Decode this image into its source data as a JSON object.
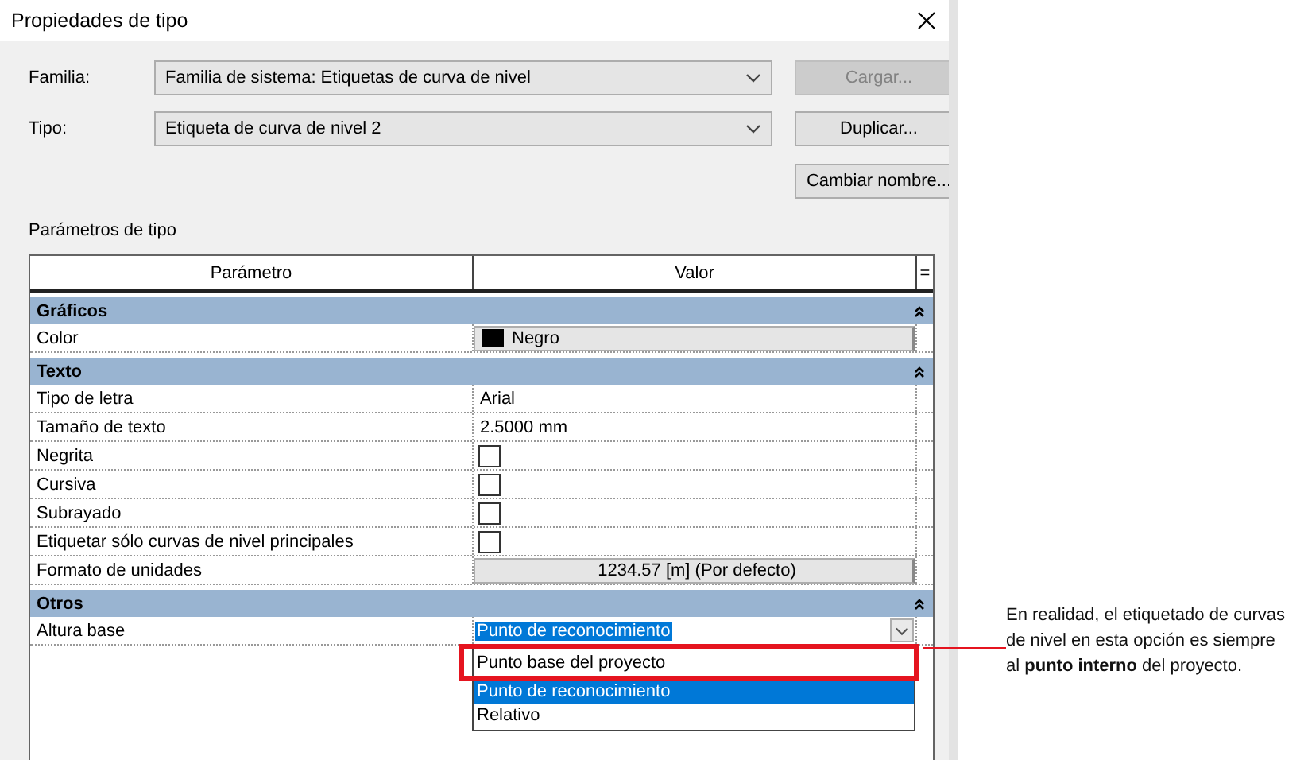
{
  "window": {
    "title": "Propiedades de tipo"
  },
  "selectors": [
    {
      "label": "Familia:",
      "value": "Familia de sistema: Etiquetas de curva de nivel"
    },
    {
      "label": "Tipo:",
      "value": "Etiqueta de curva de nivel 2"
    }
  ],
  "buttons": [
    {
      "label": "Cargar...",
      "disabled": true
    },
    {
      "label": "Duplicar...",
      "disabled": false
    },
    {
      "label": "Cambiar nombre...",
      "disabled": false
    }
  ],
  "parameters_label": "Parámetros de tipo",
  "table": {
    "columns": [
      "Parámetro",
      "Valor",
      "="
    ],
    "groups": [
      {
        "name": "Gráficos",
        "expanded": true,
        "rows": [
          {
            "name": "Color",
            "kind": "color",
            "value": "Negro",
            "color": "#000000"
          }
        ]
      },
      {
        "name": "Texto",
        "expanded": true,
        "rows": [
          {
            "name": "Tipo de letra",
            "kind": "text",
            "value": "Arial"
          },
          {
            "name": "Tamaño de texto",
            "kind": "text",
            "value": "2.5000 mm"
          },
          {
            "name": "Negrita",
            "kind": "checkbox",
            "checked": false
          },
          {
            "name": "Cursiva",
            "kind": "checkbox",
            "checked": false
          },
          {
            "name": "Subrayado",
            "kind": "checkbox",
            "checked": false
          },
          {
            "name": "Etiquetar sólo curvas de nivel principales",
            "kind": "checkbox",
            "checked": false
          },
          {
            "name": "Formato de unidades",
            "kind": "button",
            "value": "1234.57 [m] (Por defecto)"
          }
        ]
      },
      {
        "name": "Otros",
        "expanded": true,
        "rows": [
          {
            "name": "Altura base",
            "kind": "dropdown",
            "value": "Punto de reconocimiento",
            "open": true,
            "options": [
              {
                "label": "Punto base del proyecto",
                "selected": false,
                "highlighted": true
              },
              {
                "label": "Punto de reconocimiento",
                "selected": true
              },
              {
                "label": "Relativo",
                "selected": false
              }
            ]
          }
        ]
      }
    ]
  },
  "callout": {
    "text": "En realidad, el etiquetado de curvas de nivel en esta opción es siempre al **punto interno** del proyecto."
  }
}
